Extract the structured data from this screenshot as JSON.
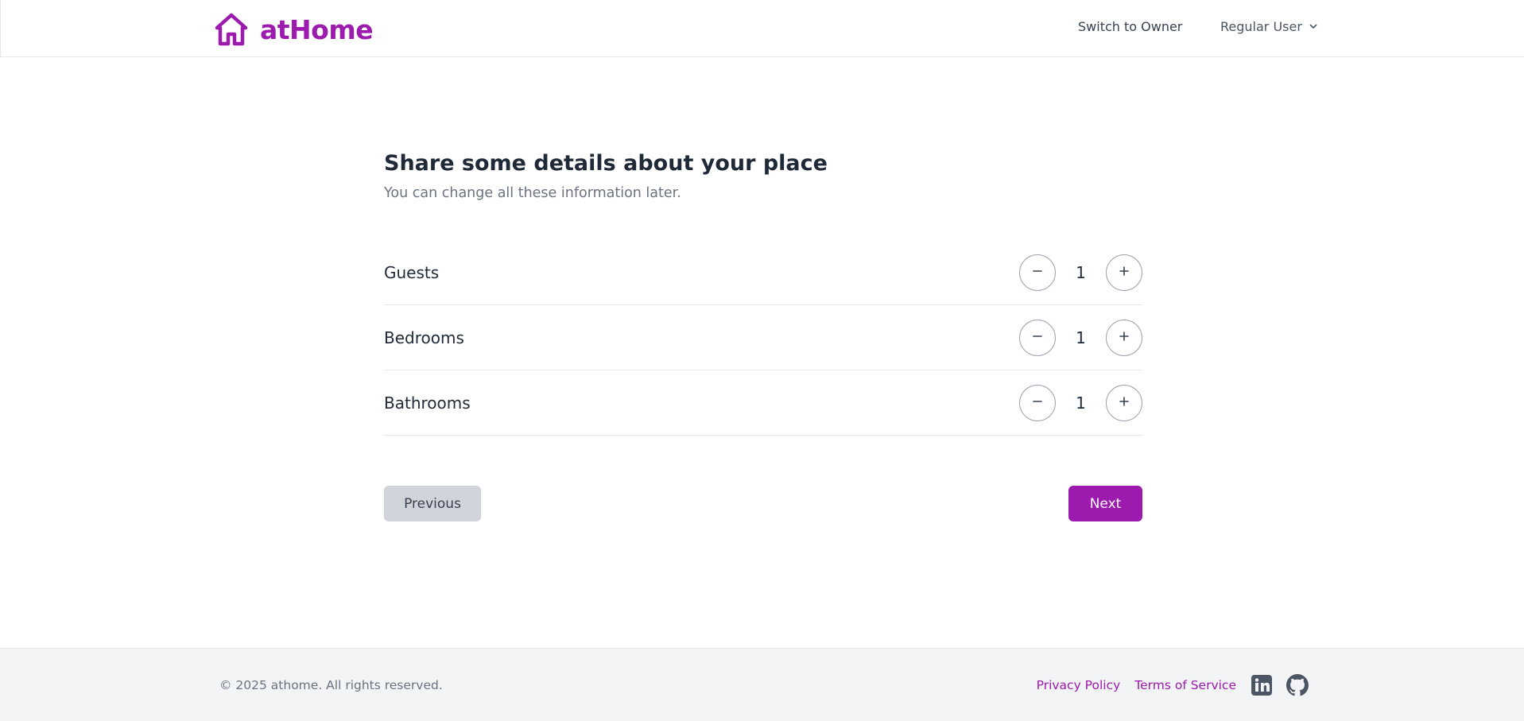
{
  "colors": {
    "brand": "#9c1aad",
    "text_dark": "#1f2937",
    "text_muted": "#6b7280",
    "button_secondary_bg": "#d1d5db",
    "footer_bg": "#f3f4f6"
  },
  "header": {
    "logo_icon": "house-icon",
    "brand_name": "atHome",
    "switch_label": "Switch to Owner",
    "user_menu_label": "Regular User",
    "user_menu_icon": "chevron-down-icon"
  },
  "main": {
    "title": "Share some details about your place",
    "subtitle": "You can change all these information later.",
    "counters": [
      {
        "label": "Guests",
        "value": "1",
        "decrement_icon": "minus-icon",
        "increment_icon": "plus-icon"
      },
      {
        "label": "Bedrooms",
        "value": "1",
        "decrement_icon": "minus-icon",
        "increment_icon": "plus-icon"
      },
      {
        "label": "Bathrooms",
        "value": "1",
        "decrement_icon": "minus-icon",
        "increment_icon": "plus-icon"
      }
    ],
    "previous_label": "Previous",
    "next_label": "Next"
  },
  "footer": {
    "copyright": "© 2025 athome. All rights reserved.",
    "privacy_label": "Privacy Policy",
    "terms_label": "Terms of Service",
    "social_icons": [
      "linkedin-icon",
      "github-icon"
    ]
  }
}
